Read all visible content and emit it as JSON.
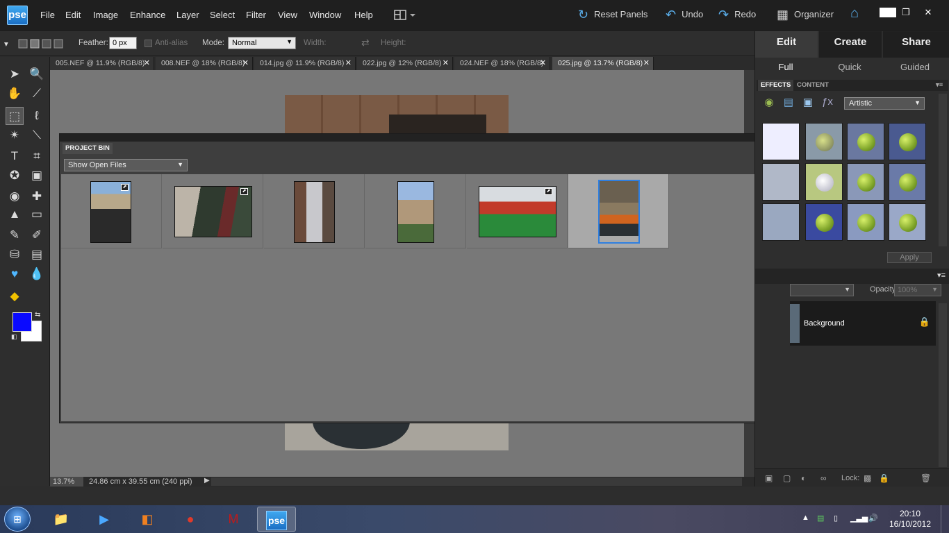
{
  "app": {
    "logo_text": "pse",
    "menu": [
      "File",
      "Edit",
      "Image",
      "Enhance",
      "Layer",
      "Select",
      "Filter",
      "View",
      "Window",
      "Help"
    ],
    "reset_panels": "Reset Panels",
    "undo": "Undo",
    "redo": "Redo",
    "organizer": "Organizer"
  },
  "options_bar": {
    "feather_label": "Feather:",
    "feather_value": "0 px",
    "anti_alias_label": "Anti-alias",
    "mode_label": "Mode:",
    "mode_value": "Normal",
    "width_label": "Width:",
    "height_label": "Height:"
  },
  "doc_tabs": [
    {
      "label": "005.NEF @ 11.9% (RGB/8)",
      "active": false
    },
    {
      "label": "008.NEF @ 18% (RGB/8)",
      "active": false
    },
    {
      "label": "014.jpg @ 11.9% (RGB/8)",
      "active": false
    },
    {
      "label": "022.jpg @ 12% (RGB/8)",
      "active": false
    },
    {
      "label": "024.NEF @ 18% (RGB/8)",
      "active": false
    },
    {
      "label": "025.jpg @ 13.7% (RGB/8)",
      "active": true
    }
  ],
  "status_bar": {
    "zoom": "13.7%",
    "doc_size": "24.86 cm x 39.55 cm (240 ppi)"
  },
  "project_bin": {
    "title": "PROJECT BIN",
    "show_select": "Show Open Files",
    "thumbnails": 6,
    "selected_index": 5
  },
  "right_panel": {
    "mode_tabs": [
      "Edit",
      "Create",
      "Share"
    ],
    "active_mode": "Edit",
    "sub_tabs": [
      "Full",
      "Quick",
      "Guided"
    ],
    "active_sub": "Full",
    "effects_tab": "EFFECTS",
    "content_tab": "CONTENT",
    "effects_category": "Artistic",
    "apply_label": "Apply",
    "opacity_label": "Opacity:",
    "opacity_value": "100%",
    "layer_name": "Background",
    "lock_label": "Lock:"
  },
  "taskbar": {
    "clock_time": "20:10",
    "clock_date": "16/10/2012",
    "active_app": "pse"
  },
  "colors": {
    "foreground": "#0a0aff",
    "background": "#ffffff",
    "accent": "#3f8fe0"
  }
}
